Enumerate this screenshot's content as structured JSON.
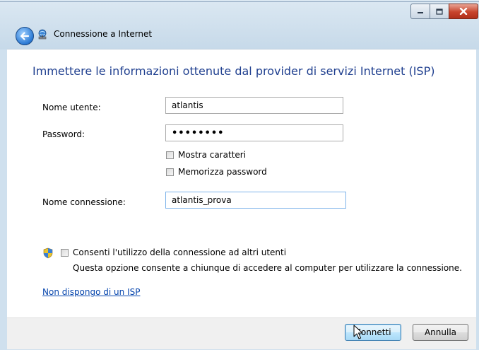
{
  "window": {
    "title": "Connessione a Internet"
  },
  "content": {
    "heading": "Immettere le informazioni ottenute dal provider di servizi Internet (ISP)",
    "username": {
      "label": "Nome utente:",
      "value": "atlantis"
    },
    "password": {
      "label": "Password:",
      "value": "••••••••"
    },
    "show_chars": {
      "label": "Mostra caratteri",
      "checked": false
    },
    "remember_pwd": {
      "label": "Memorizza password",
      "checked": false
    },
    "connection_name": {
      "label": "Nome connessione:",
      "value": "atlantis_prova"
    },
    "allow_others": {
      "label": "Consenti l'utilizzo della connessione ad altri utenti",
      "description": "Questa opzione consente a chiunque di accedere al computer per utilizzare la connessione.",
      "checked": false
    },
    "no_isp_link": "Non dispongo di un ISP"
  },
  "footer": {
    "connect_label": "Connetti",
    "cancel_label": "Annulla"
  },
  "icons": {
    "back": "back-arrow-icon",
    "app": "network-connection-icon",
    "shield": "uac-shield-icon"
  }
}
